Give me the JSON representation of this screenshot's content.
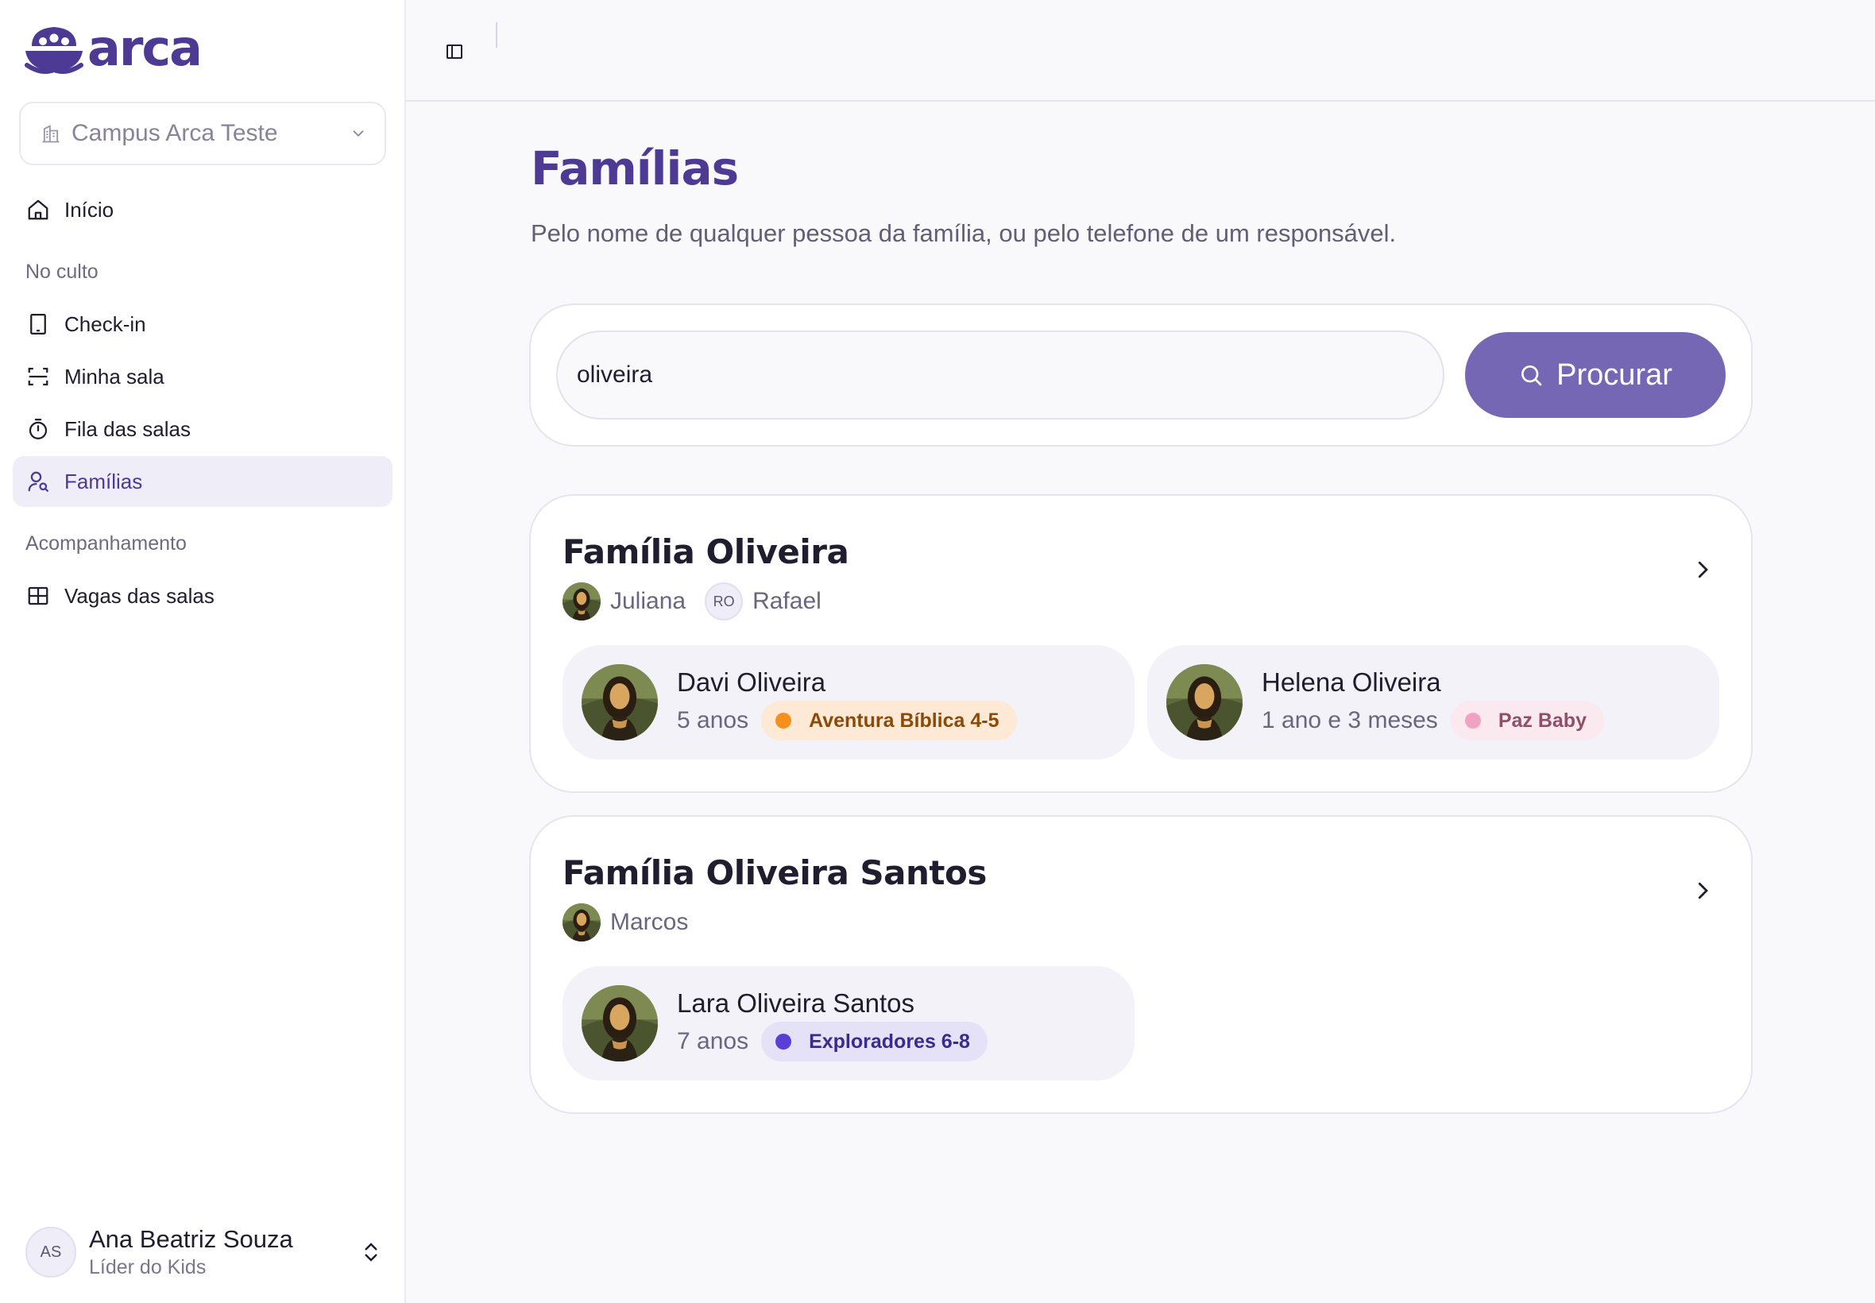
{
  "app": {
    "name": "arca"
  },
  "sidebar": {
    "campus": {
      "label": "Campus Arca Teste"
    },
    "home_label": "Início",
    "sections": [
      {
        "title": "No culto"
      },
      {
        "title": "Acompanhamento"
      }
    ],
    "items": [
      {
        "label": "Check-in"
      },
      {
        "label": "Minha sala"
      },
      {
        "label": "Fila das salas"
      },
      {
        "label": "Famílias",
        "active": true
      },
      {
        "label": "Vagas das salas"
      }
    ],
    "user": {
      "initials": "AS",
      "name": "Ana Beatriz Souza",
      "role": "Líder do Kids"
    }
  },
  "page": {
    "title": "Famílias",
    "subtitle": "Pelo nome de qualquer pessoa da família, ou pelo telefone de um responsável."
  },
  "search": {
    "value": "oliveira",
    "button_label": "Procurar"
  },
  "families": [
    {
      "name": "Família Oliveira",
      "guardians": [
        {
          "name": "Juliana",
          "photo": true
        },
        {
          "name": "Rafael",
          "initials": "RO"
        }
      ],
      "children": [
        {
          "name": "Davi Oliveira",
          "age": "5 anos",
          "room": "Aventura Bíblica 4-5",
          "room_color": "#f5901e",
          "badge_bg": "#fde9d6",
          "badge_fg": "#8a4b08"
        },
        {
          "name": "Helena Oliveira",
          "age": "1 ano e 3 meses",
          "room": "Paz Baby",
          "room_color": "#f0a3c0",
          "badge_bg": "#fbe9f0",
          "badge_fg": "#8e4f68"
        }
      ]
    },
    {
      "name": "Família Oliveira Santos",
      "guardians": [
        {
          "name": "Marcos",
          "photo": true
        }
      ],
      "children": [
        {
          "name": "Lara Oliveira Santos",
          "age": "7 anos",
          "room": "Exploradores 6-8",
          "room_color": "#5a3fd6",
          "badge_bg": "#e5e1f7",
          "badge_fg": "#3a2b8c"
        }
      ]
    }
  ],
  "colors": {
    "brand": "#4d3a94",
    "button": "#7567b3",
    "active_nav_bg": "#efedf7"
  }
}
